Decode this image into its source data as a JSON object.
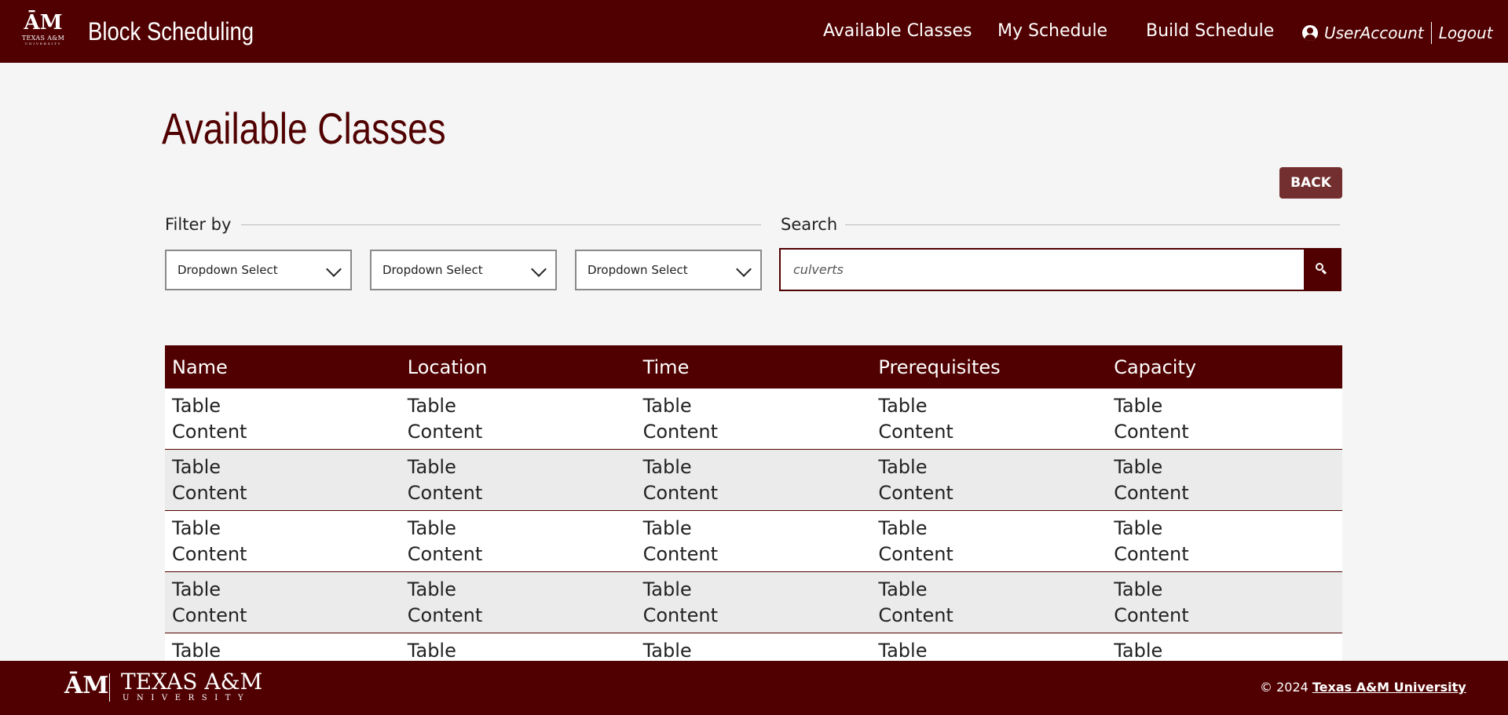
{
  "nav": {
    "logo_mark": "ĀM",
    "logo_wordmark": "TEXAS A&M",
    "logo_univ": "UNIVERSITY",
    "brand": "Block Scheduling",
    "links": [
      "Available Classes",
      "My Schedule",
      "Build Schedule"
    ],
    "user_label": "UserAccount",
    "logout_label": "Logout"
  },
  "page": {
    "title": "Available Classes",
    "back_label": "BACK"
  },
  "filters": {
    "label": "Filter by",
    "dropdowns": [
      "Dropdown Select",
      "Dropdown Select",
      "Dropdown Select"
    ]
  },
  "search": {
    "label": "Search",
    "value": "culverts"
  },
  "table": {
    "headers": [
      "Name",
      "Location",
      "Time",
      "Prerequisites",
      "Capacity"
    ],
    "cell_text": "Table Content",
    "partial_cell_text": "Table"
  },
  "footer": {
    "logo_mark": "ĀM",
    "wordmark": "TEXAS A&M",
    "univ": "UNIVERSITY",
    "copyright": "© 2024 ",
    "copyright_link": "Texas A&M University"
  },
  "colors": {
    "maroon": "#500000",
    "button": "#732f2f",
    "background": "#f5f5f5",
    "row_alt": "#ebebeb"
  }
}
